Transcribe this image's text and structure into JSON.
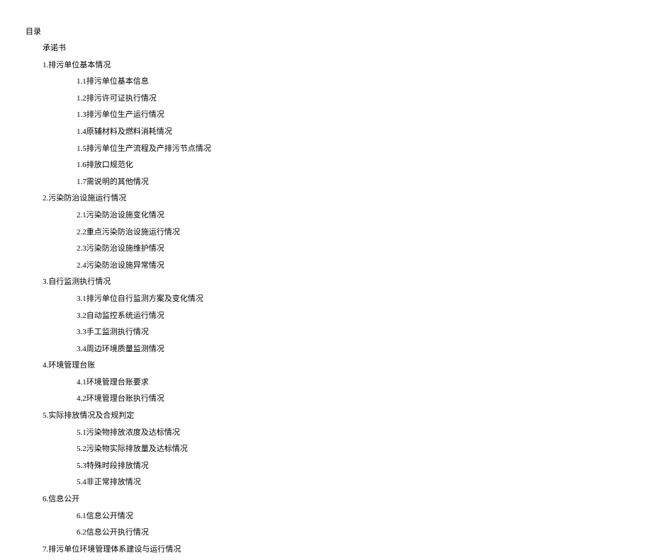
{
  "title": "目录",
  "entries": [
    {
      "level": 1,
      "label": "承诺书"
    },
    {
      "level": 1,
      "label": "1.排污单位基本情况"
    },
    {
      "level": 2,
      "label": "1.1排污单位基本信息"
    },
    {
      "level": 2,
      "label": "1.2排污许可证执行情况"
    },
    {
      "level": 2,
      "label": "1.3排污单位生产运行情况"
    },
    {
      "level": 2,
      "label": "1.4原辅材料及燃料消耗情况"
    },
    {
      "level": 2,
      "label": "1.5排污单位生产流程及产排污节点情况"
    },
    {
      "level": 2,
      "label": "1.6排放口规范化"
    },
    {
      "level": 2,
      "label": "1.7需说明的其他情况"
    },
    {
      "level": 1,
      "label": "2.污染防治设施运行情况"
    },
    {
      "level": 2,
      "label": "2.1污染防治设施变化情况"
    },
    {
      "level": 2,
      "label": "2.2重点污染防治设施运行情况"
    },
    {
      "level": 2,
      "label": "2.3污染防治设施维护情况"
    },
    {
      "level": 2,
      "label": "2.4污染防治设施异常情况"
    },
    {
      "level": 1,
      "label": "3.自行监测执行情况"
    },
    {
      "level": 2,
      "label": "3.1排污单位自行监测方案及变化情况"
    },
    {
      "level": 2,
      "label": "3.2自动监控系统运行情况"
    },
    {
      "level": 2,
      "label": "3.3手工监测执行情况"
    },
    {
      "level": 2,
      "label": "3.4周边环境质量监测情况"
    },
    {
      "level": 1,
      "label": "4.环境管理台账"
    },
    {
      "level": 2,
      "label": "4.1环境管理台账要求"
    },
    {
      "level": 2,
      "label": "4.2环境管理台账执行情况"
    },
    {
      "level": 1,
      "label": "5.实际排放情况及合规判定"
    },
    {
      "level": 2,
      "label": "5.1污染物排放浓度及达标情况"
    },
    {
      "level": 2,
      "label": "5.2污染物实际排放量及达标情况"
    },
    {
      "level": 2,
      "label": "5.3特殊时段排放情况"
    },
    {
      "level": 2,
      "label": "5.4非正常排放情况"
    },
    {
      "level": 1,
      "label": "6.信息公开"
    },
    {
      "level": 2,
      "label": "6.1信息公开情况"
    },
    {
      "level": 2,
      "label": "6.2信息公开执行情况"
    },
    {
      "level": 1,
      "label": "7.排污单位环境管理体系建设与运行情况"
    }
  ]
}
